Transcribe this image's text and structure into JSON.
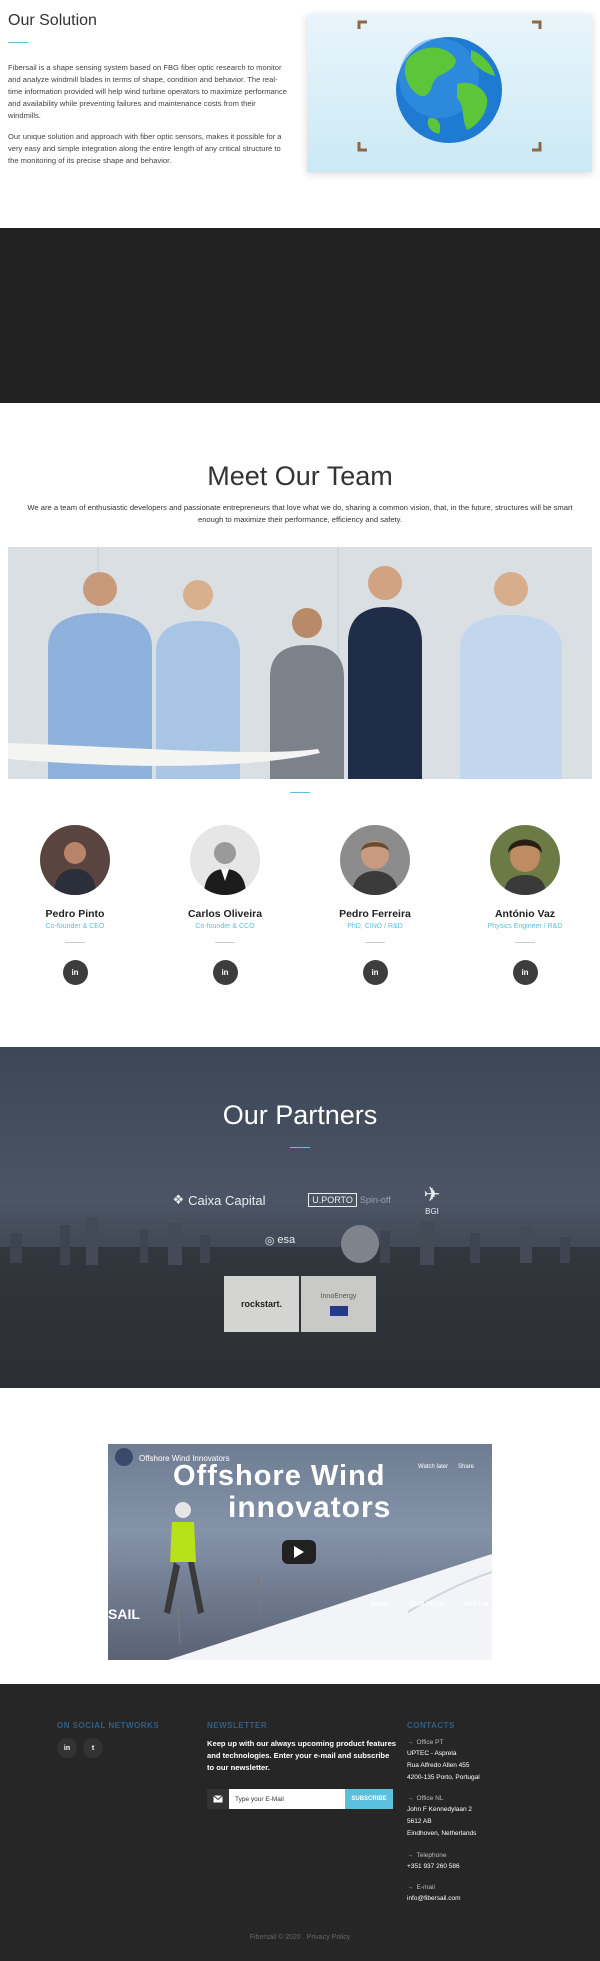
{
  "solution": {
    "title": "Our Solution",
    "p1": "Fibersail is a shape sensing system based on FBG fiber optic research to monitor and analyze windmill blades in terms of shape, condition and behavior. The real-time information provided will help wind turbine operators to maximize performance and availability while preventing failures and maintenance costs from their windmills.",
    "p2": "Our unique solution and approach with fiber optic sensors, makes it possible for a very easy and simple integration along the entire length of any critical structure to the monitoring of its precise shape and behavior."
  },
  "team": {
    "title": "Meet Our Team",
    "intro": "We are a team of enthusiastic developers and passionate entrepreneurs that love what we do, sharing a common vision, that, in the future, structures will be smart enough to maximize their performance, efficiency and safety.",
    "members": [
      {
        "name": "Pedro Pinto",
        "role": "Co-founder & CEO",
        "social": "in"
      },
      {
        "name": "Carlos Oliveira",
        "role": "Co-founder & CCO",
        "social": "in"
      },
      {
        "name": "Pedro Ferreira",
        "role": "PhD, CINO / R&D",
        "social": "in"
      },
      {
        "name": "António Vaz",
        "role": "Physics Engineer / R&D",
        "social": "in"
      }
    ]
  },
  "partners": {
    "title": "Our Partners",
    "logos": [
      {
        "text": "Caixa Capital"
      },
      {
        "text": "U.PORTO",
        "sub": "Spin-off"
      },
      {
        "text": "BGI"
      },
      {
        "text": "esa"
      },
      {
        "text": "rockstart."
      },
      {
        "text": "InnoEnergy"
      }
    ]
  },
  "video": {
    "title": "Offshore Wind Innovators",
    "headline1": "Offshore Wind",
    "headline2": "innovators",
    "watch_later": "Watch later",
    "share": "Share",
    "nav": [
      "HOME",
      "OUR TEAM",
      "PARTNE"
    ],
    "brand": "SAIL"
  },
  "footer": {
    "social_title": "ON SOCIAL NETWORKS",
    "social": [
      "in",
      "t"
    ],
    "newsletter_title": "NEWSLETTER",
    "newsletter_text": "Keep up with our always upcoming product features and technologies. Enter your e-mail and subscribe to our newsletter.",
    "email_placeholder": "Type your E-Mail",
    "subscribe_label": "SUBSCRIBE",
    "contacts_title": "CONTACTS",
    "contacts": [
      {
        "label": "Office PT",
        "lines": [
          "UPTEC - Asprela",
          "Rua Alfredo Allen 455",
          "4200-135 Porto, Portugal"
        ]
      },
      {
        "label": "Office NL",
        "lines": [
          "John F Kennedylaan 2",
          "5612 AB",
          "Eindhoven, Netherlands"
        ]
      },
      {
        "label": "Telephone",
        "lines": [
          "+351 937 260 586"
        ]
      },
      {
        "label": "E-mail",
        "lines": [
          "info@fibersail.com"
        ]
      }
    ],
    "copyright": "Fibersail © 2020 . Privacy Policy"
  },
  "colors": {
    "accent": "#5bc0de",
    "dark": "#222222",
    "footer": "#262626"
  }
}
